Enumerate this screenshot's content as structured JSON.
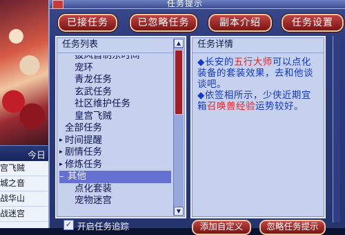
{
  "window": {
    "title": "任务提示"
  },
  "side_panel": {
    "header": "今日",
    "items": [
      "宫飞贼",
      "城之音",
      "战华山",
      "战迷宫"
    ]
  },
  "tabs": [
    {
      "label": "已接任务"
    },
    {
      "label": "已忽略任务"
    },
    {
      "label": "副本介绍"
    },
    {
      "label": "任务设置"
    }
  ],
  "task_list": {
    "header": "任务列表",
    "items": [
      {
        "label": "披风首制东时间",
        "indent": 2,
        "arrow": false,
        "selected": false
      },
      {
        "label": "宠环",
        "indent": 2,
        "arrow": false,
        "selected": false
      },
      {
        "label": "青龙任务",
        "indent": 2,
        "arrow": false,
        "selected": false
      },
      {
        "label": "玄武任务",
        "indent": 2,
        "arrow": false,
        "selected": false
      },
      {
        "label": "社区维护任务",
        "indent": 2,
        "arrow": false,
        "selected": false
      },
      {
        "label": "皇宫飞贼",
        "indent": 2,
        "arrow": false,
        "selected": false
      },
      {
        "label": "全部任务",
        "indent": 1,
        "arrow": false,
        "selected": false
      },
      {
        "label": "时间提醒",
        "indent": 1,
        "arrow": true,
        "selected": false
      },
      {
        "label": "剧情任务",
        "indent": 1,
        "arrow": true,
        "selected": false
      },
      {
        "label": "修炼任务",
        "indent": 1,
        "arrow": true,
        "selected": false
      },
      {
        "label": "其他",
        "indent": 1,
        "arrow": false,
        "selected": true
      },
      {
        "label": "点化套装",
        "indent": 2,
        "arrow": false,
        "selected": false
      },
      {
        "label": "宠物迷宫",
        "indent": 2,
        "arrow": false,
        "selected": false
      }
    ]
  },
  "task_detail": {
    "header": "任务详情",
    "para1": {
      "bullet": "◆",
      "before": "长安的",
      "highlight": "五行大师",
      "after": "可以点化装备的套装效果，去和他谈谈吧。"
    },
    "para2": {
      "bullet": "◆",
      "before": "依签相所示，少侠近期宜箱",
      "highlight": "召唤兽经验",
      "after": "运势较好。"
    }
  },
  "footer": {
    "checkbox_label": "开启任务追踪",
    "checkbox_checked": true,
    "button1": "添加自定义",
    "button2": "忽略任务提示"
  }
}
